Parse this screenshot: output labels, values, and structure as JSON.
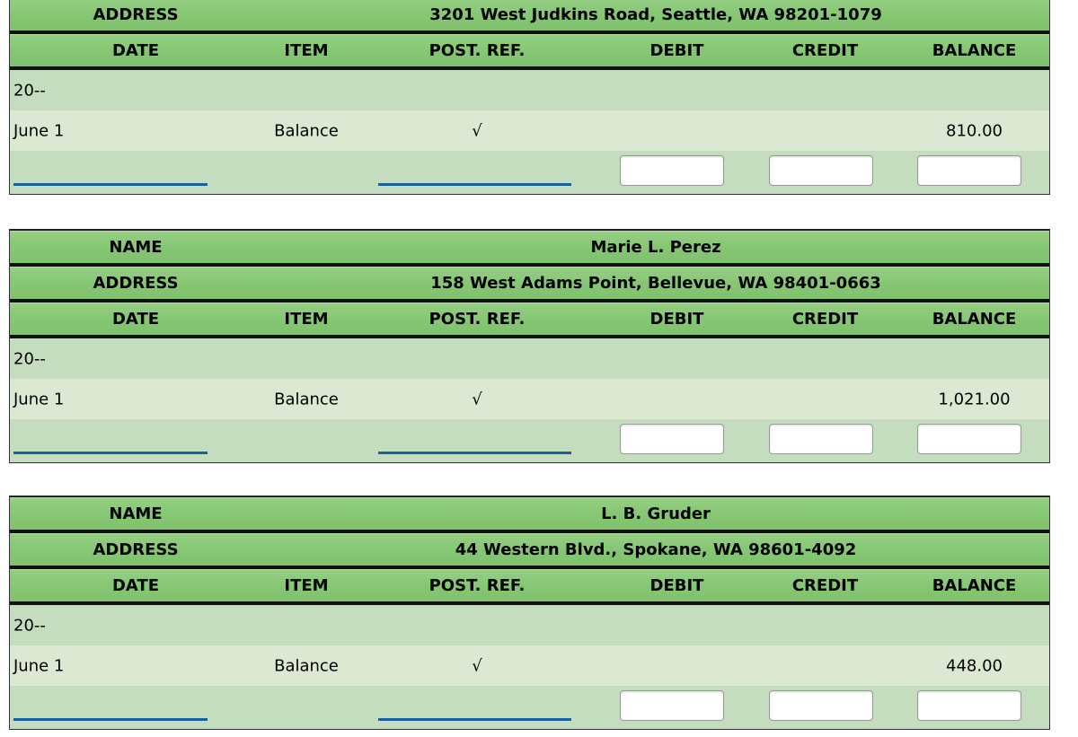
{
  "labels": {
    "name": "NAME",
    "address": "ADDRESS",
    "date": "DATE",
    "item": "ITEM",
    "post_ref": "POST. REF.",
    "debit": "DEBIT",
    "credit": "CREDIT",
    "balance": "BALANCE"
  },
  "ledgers": [
    {
      "address": "3201 West Judkins Road, Seattle, WA 98201-1079",
      "year": "20--",
      "date": "June 1",
      "item": "Balance",
      "post_ref": "√",
      "balance": "810.00"
    },
    {
      "name": "Marie L. Perez",
      "address": "158 West Adams Point, Bellevue, WA 98401-0663",
      "year": "20--",
      "date": "June 1",
      "item": "Balance",
      "post_ref": "√",
      "balance": "1,021.00"
    },
    {
      "name": "L. B. Gruder",
      "address": "44 Western Blvd., Spokane, WA 98601-4092",
      "year": "20--",
      "date": "June 1",
      "item": "Balance",
      "post_ref": "√",
      "balance": "448.00"
    }
  ],
  "colors": {
    "header_green": "#86c774",
    "row_dark": "#c5ddbf",
    "row_light": "#dde8d3",
    "underline_blue": "#1a5fa0"
  }
}
